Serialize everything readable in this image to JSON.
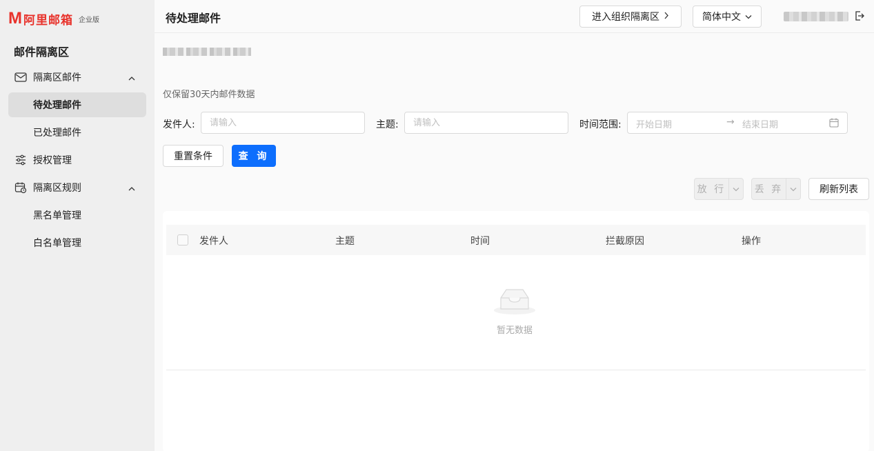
{
  "brand": {
    "logo_mark": "M",
    "logo_text": "阿里邮箱",
    "edition": "企业版"
  },
  "sidebar": {
    "section_title": "邮件隔离区",
    "items": [
      {
        "label": "隔离区邮件",
        "icon": "mail-icon",
        "expanded": true
      },
      {
        "label": "待处理邮件",
        "active": true
      },
      {
        "label": "已处理邮件"
      },
      {
        "label": "授权管理",
        "icon": "sliders-icon"
      },
      {
        "label": "隔离区规则",
        "icon": "calendar-clock-icon",
        "expanded": true
      },
      {
        "label": "黑名单管理"
      },
      {
        "label": "白名单管理"
      }
    ]
  },
  "header": {
    "title": "待处理邮件",
    "org_button": "进入组织隔离区",
    "language": "简体中文"
  },
  "main": {
    "retention_note": "仅保留30天内邮件数据",
    "filters": {
      "sender_label": "发件人:",
      "sender_placeholder": "请输入",
      "subject_label": "主题:",
      "subject_placeholder": "请输入",
      "time_label": "时间范围:",
      "start_placeholder": "开始日期",
      "end_placeholder": "结束日期"
    },
    "reset_button": "重置条件",
    "query_button": "查 询",
    "release_button": "放 行",
    "discard_button": "丢 弃",
    "refresh_button": "刷新列表",
    "table": {
      "columns": [
        "发件人",
        "主题",
        "时间",
        "拦截原因",
        "操作"
      ],
      "rows": [],
      "empty_text": "暂无数据"
    }
  },
  "colors": {
    "brand_red": "#e8322b",
    "primary_blue": "#0d6efd"
  }
}
